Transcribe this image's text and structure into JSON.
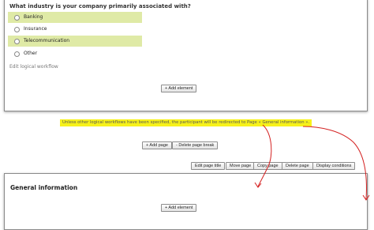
{
  "question": {
    "text": "What industry is your company primarily associated with?",
    "options": [
      {
        "label": "Banking",
        "highlighted": true
      },
      {
        "label": "Insurance",
        "highlighted": false
      },
      {
        "label": "Telecommunication",
        "highlighted": true
      },
      {
        "label": "Other",
        "highlighted": false
      }
    ]
  },
  "edit_workflow_link": "Edit logical workflow",
  "add_element_label": "+ Add element",
  "notice": "Unless other logical workflows have been specified, the participant will be redirected to Page « General information ».",
  "page_buttons": {
    "add_page": "+ Add page",
    "delete_page_break": "- Delete page break"
  },
  "toolbar": {
    "edit_page_title": "Edit page title",
    "move_page": "Move page",
    "copy_page": "Copy page",
    "delete_page": "Delete page",
    "display_conditions": "Display conditions"
  },
  "section": {
    "title": "General information",
    "add_element_label": "+ Add element"
  },
  "colors": {
    "highlight": "#dfeaa6",
    "notice_bg": "#f7f21a",
    "annotation": "#d42020"
  }
}
